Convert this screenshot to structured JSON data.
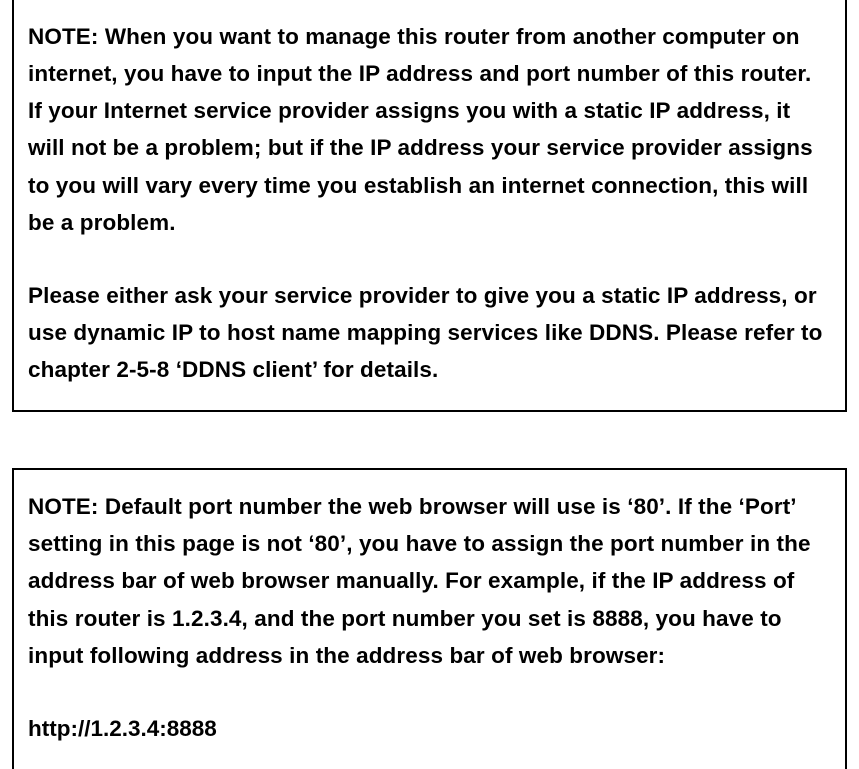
{
  "notes": {
    "note1": {
      "para1": "NOTE: When you want to manage this router from another computer on internet, you have to input the IP address and port number of this router. If your Internet service provider assigns you with a static IP address, it will not be a problem; but if the IP address your service provider assigns to you will vary every time you establish an internet connection, this will be a problem.",
      "para2": "Please either ask your service provider to give you a static IP address, or use dynamic IP to host name mapping services like DDNS. Please refer to chapter 2-5-8 ‘DDNS client’ for details."
    },
    "note2": {
      "para1": "NOTE: Default port number the web browser will use is ‘80’. If the ‘Port’ setting in this page is not ‘80’, you have to assign the port number in the address bar of web browser manually. For example, if the IP address of this router is 1.2.3.4, and the port number you set is 8888, you have to input following address in the address bar of web browser:",
      "url": "http://1.2.3.4:8888"
    }
  }
}
